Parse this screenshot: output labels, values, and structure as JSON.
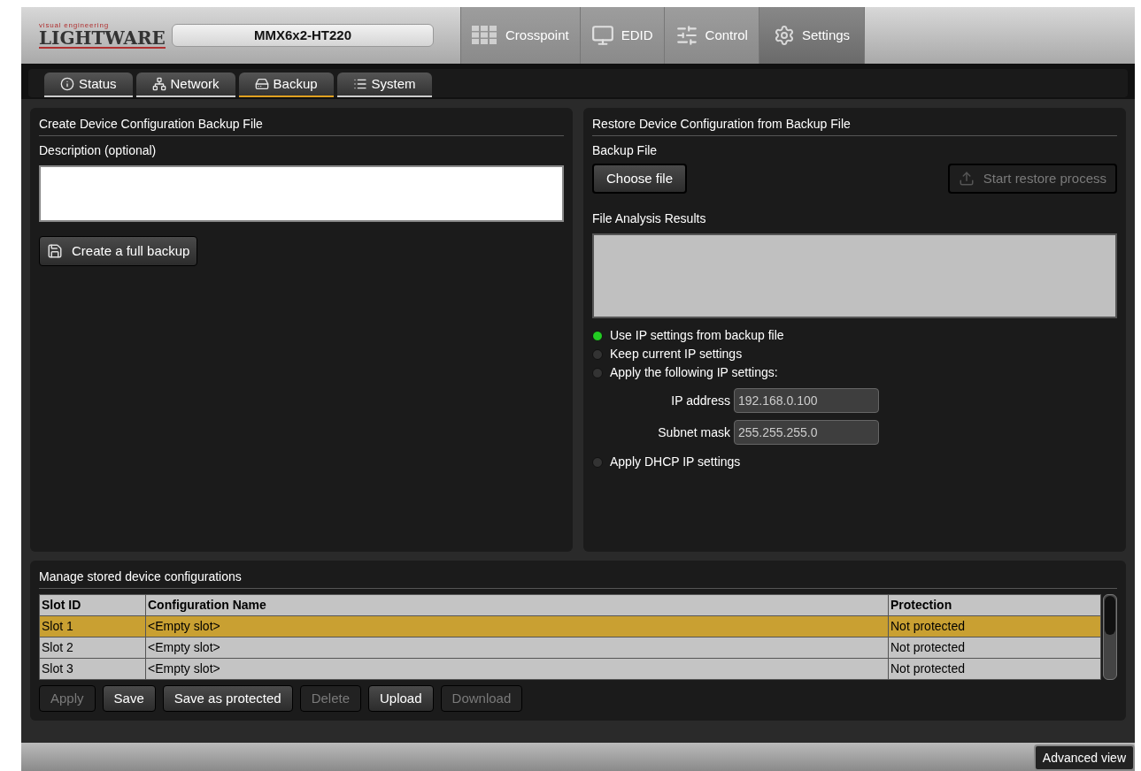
{
  "header": {
    "logo_tagline": "visual engineering",
    "logo": "LIGHTWARE",
    "device_name": "MMX6x2-HT220",
    "nav": [
      {
        "label": "Crosspoint",
        "kind": "grid",
        "selected": false
      },
      {
        "label": "EDID",
        "kind": "monitor",
        "selected": false
      },
      {
        "label": "Control",
        "kind": "sliders",
        "selected": false
      },
      {
        "label": "Settings",
        "kind": "gears",
        "selected": true
      }
    ]
  },
  "subtabs": [
    {
      "label": "Status",
      "kind": "info",
      "selected": false
    },
    {
      "label": "Network",
      "kind": "network",
      "selected": false
    },
    {
      "label": "Backup",
      "kind": "drive",
      "selected": true
    },
    {
      "label": "System",
      "kind": "list",
      "selected": false
    }
  ],
  "backup_panel": {
    "title": "Create Device Configuration Backup File",
    "description_label": "Description (optional)",
    "create_button": "Create a full backup"
  },
  "restore_panel": {
    "title": "Restore Device Configuration from Backup File",
    "file_label": "Backup File",
    "choose_button": "Choose file",
    "start_button": {
      "label": "Start restore process",
      "disabled": true
    },
    "results_label": "File Analysis Results",
    "options": [
      {
        "label": "Use IP settings from backup file",
        "selected": true
      },
      {
        "label": "Keep current IP settings",
        "selected": false
      },
      {
        "label": "Apply the following IP settings:",
        "selected": false,
        "fields": [
          {
            "label": "IP address",
            "value": "192.168.0.100"
          },
          {
            "label": "Subnet mask",
            "value": "255.255.255.0"
          }
        ]
      },
      {
        "label": "Apply DHCP IP settings",
        "selected": false
      }
    ]
  },
  "slots_panel": {
    "title": "Manage stored device configurations",
    "table": {
      "columns": [
        "Slot ID",
        "Configuration Name",
        "Protection"
      ],
      "rows": [
        {
          "cells": [
            "Slot 1",
            "<Empty slot>",
            "Not protected"
          ],
          "selected": true
        },
        {
          "cells": [
            "Slot 2",
            "<Empty slot>",
            "Not protected"
          ],
          "selected": false
        },
        {
          "cells": [
            "Slot 3",
            "<Empty slot>",
            "Not protected"
          ],
          "selected": false
        }
      ]
    },
    "buttons": [
      {
        "label": "Apply",
        "disabled": true
      },
      {
        "label": "Save",
        "disabled": false
      },
      {
        "label": "Save as protected",
        "disabled": false
      },
      {
        "label": "Delete",
        "disabled": true
      },
      {
        "label": "Upload",
        "disabled": false
      },
      {
        "label": "Download",
        "disabled": true
      }
    ]
  },
  "footer": {
    "advanced_button": "Advanced view"
  }
}
